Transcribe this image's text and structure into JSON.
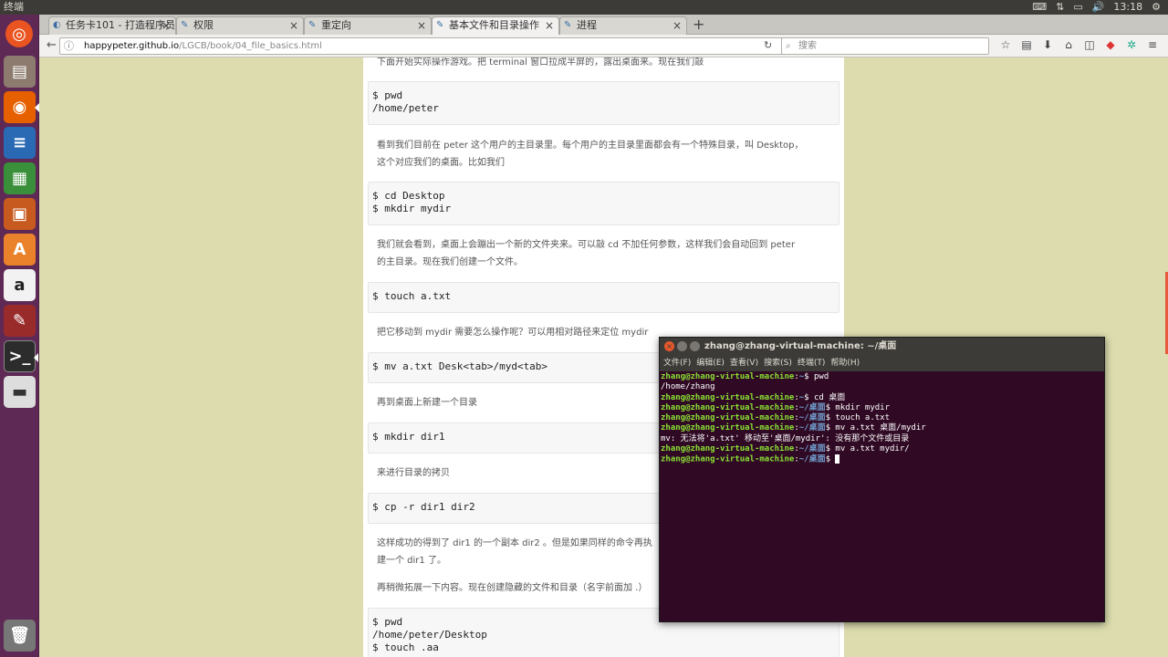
{
  "panel": {
    "app_title": "终端",
    "clock": "13:18"
  },
  "browser": {
    "tabs": [
      {
        "label": "任务卡101 - 打造程序员"
      },
      {
        "label": "权限"
      },
      {
        "label": "重定向"
      },
      {
        "label": "基本文件和目录操作"
      },
      {
        "label": "进程"
      }
    ],
    "new_tab": "+",
    "url": {
      "domain": "happypeter.github.io",
      "path": "/LGCB/book/04_file_basics.html"
    },
    "search_placeholder": "搜索"
  },
  "page": {
    "blocks": [
      {
        "type": "para",
        "text": "下面开始实际操作游戏。把 terminal 窗口拉成半屏的，露出桌面来。现在我们敲"
      },
      {
        "type": "code",
        "text": "$ pwd\n/home/peter"
      },
      {
        "type": "para",
        "text": "看到我们目前在 peter 这个用户的主目录里。每个用户的主目录里面都会有一个特殊目录，叫 Desktop，"
      },
      {
        "type": "para",
        "text": "这个对应我们的桌面。比如我们"
      },
      {
        "type": "code",
        "text": "$ cd Desktop\n$ mkdir mydir"
      },
      {
        "type": "para",
        "text": "我们就会看到，桌面上会蹦出一个新的文件夹来。可以敲 cd 不加任何参数，这样我们会自动回到 peter"
      },
      {
        "type": "para",
        "text": "的主目录。现在我们创建一个文件。"
      },
      {
        "type": "code",
        "text": "$ touch a.txt"
      },
      {
        "type": "para",
        "text": "把它移动到 mydir 需要怎么操作呢？可以用相对路径来定位 mydir"
      },
      {
        "type": "code",
        "text": "$ mv a.txt Desk<tab>/myd<tab>"
      },
      {
        "type": "para",
        "text": "再到桌面上新建一个目录"
      },
      {
        "type": "code",
        "text": "$ mkdir dir1"
      },
      {
        "type": "para",
        "text": "来进行目录的拷贝"
      },
      {
        "type": "code",
        "text": "$ cp -r dir1 dir2"
      },
      {
        "type": "para",
        "text": "这样成功的得到了 dir1 的一个副本 dir2 。但是如果同样的命令再执"
      },
      {
        "type": "para",
        "text": "建一个 dir1 了。"
      },
      {
        "type": "para",
        "text": "再稍微拓展一下内容。现在创建隐藏的文件和目录（名字前面加 .）"
      },
      {
        "type": "code",
        "text": "$ pwd\n/home/peter/Desktop\n$ touch .aa"
      }
    ]
  },
  "terminal": {
    "title": "zhang@zhang-virtual-machine: ~/桌面",
    "menu": [
      "文件(F)",
      "编辑(E)",
      "查看(V)",
      "搜索(S)",
      "终端(T)",
      "帮助(H)"
    ],
    "lines": [
      {
        "user": "zhang@zhang-virtual-machine",
        "path": "~",
        "cmd": "$ pwd"
      },
      {
        "output": "/home/zhang"
      },
      {
        "user": "zhang@zhang-virtual-machine",
        "path": "~",
        "cmd": "$ cd 桌面"
      },
      {
        "user": "zhang@zhang-virtual-machine",
        "path": "~/桌面",
        "cmd": "$ mkdir mydir"
      },
      {
        "user": "zhang@zhang-virtual-machine",
        "path": "~/桌面",
        "cmd": "$ touch a.txt"
      },
      {
        "user": "zhang@zhang-virtual-machine",
        "path": "~/桌面",
        "cmd": "$ mv a.txt 桌面/mydir"
      },
      {
        "output": "mv: 无法将'a.txt' 移动至'桌面/mydir': 没有那个文件或目录"
      },
      {
        "user": "zhang@zhang-virtual-machine",
        "path": "~/桌面",
        "cmd": "$ mv a.txt mydir/"
      },
      {
        "user": "zhang@zhang-virtual-machine",
        "path": "~/桌面",
        "cmd": "$ ",
        "cursor": true
      }
    ]
  },
  "launcher_icons": [
    "ubuntu-dash-icon",
    "files-icon",
    "firefox-icon",
    "writer-icon",
    "calc-icon",
    "impress-icon",
    "software-center-icon",
    "amazon-icon",
    "system-settings-icon",
    "terminal-icon",
    "drive-icon",
    "trash-icon"
  ]
}
